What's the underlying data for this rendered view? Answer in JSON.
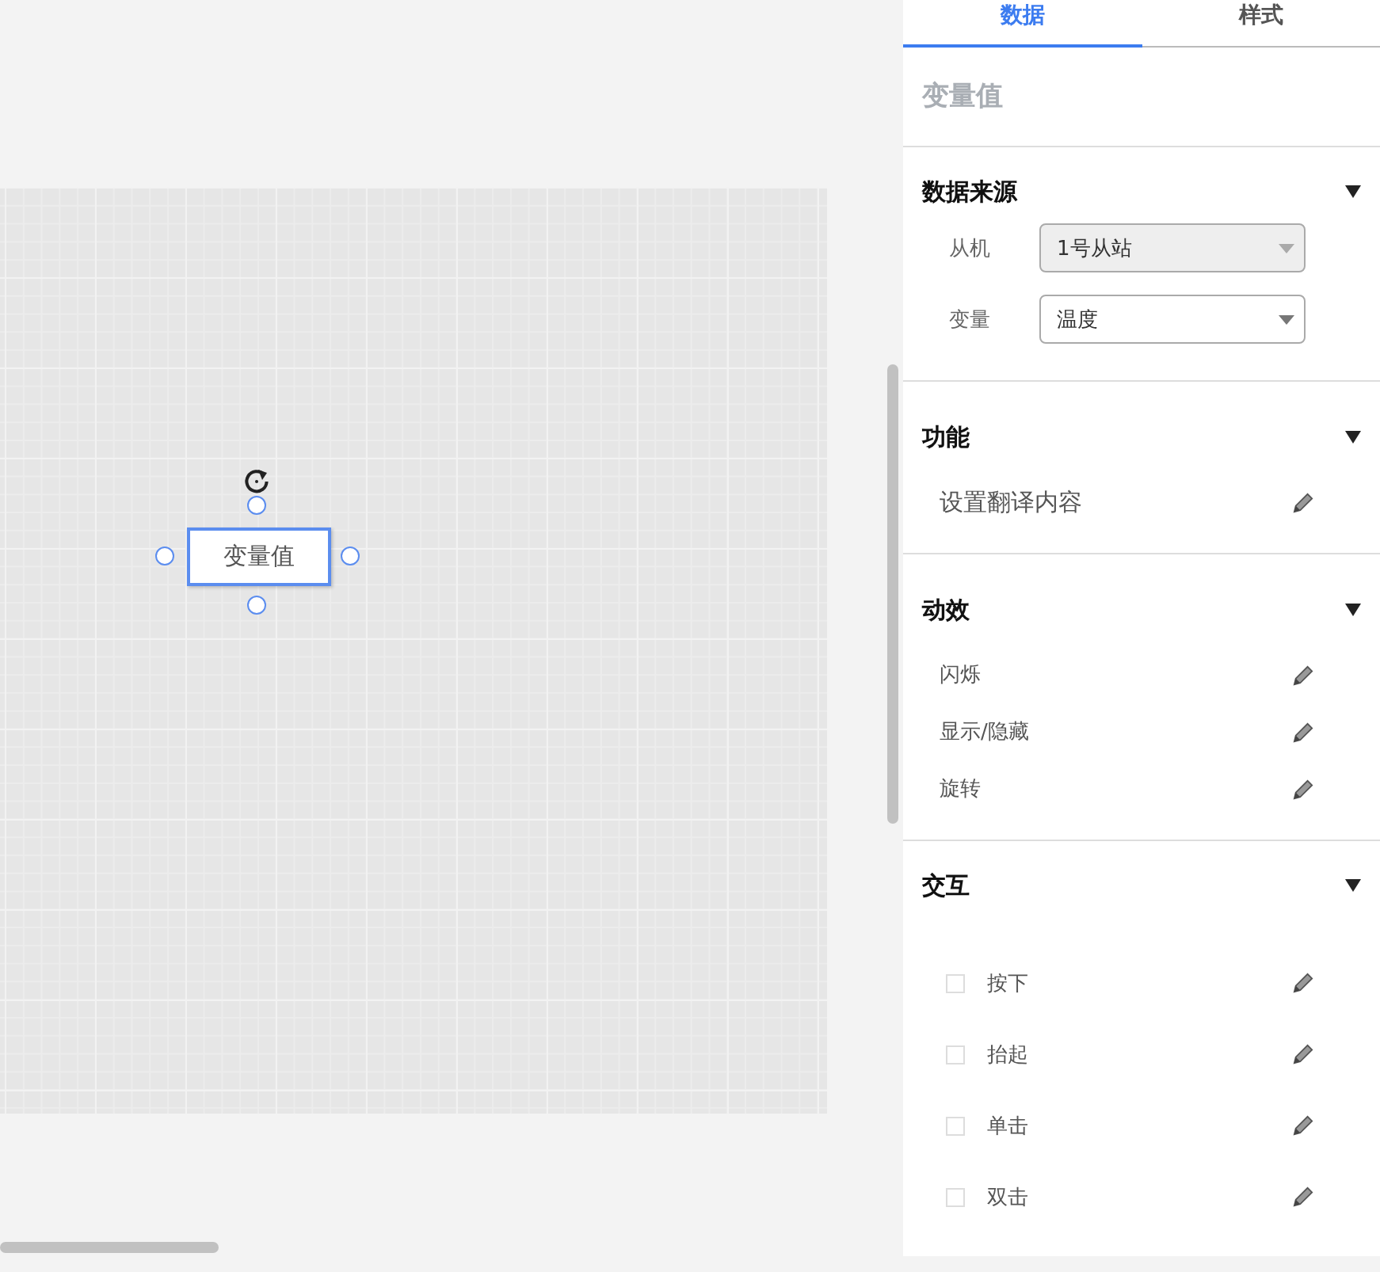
{
  "canvas": {
    "widget": {
      "label": "变量值",
      "selected": true
    }
  },
  "panel": {
    "tabs": [
      {
        "label": "数据",
        "selected": true
      },
      {
        "label": "样式",
        "selected": false
      }
    ],
    "title": "变量值",
    "sections": [
      {
        "kind": "fields",
        "title": "数据来源",
        "expanded": true,
        "fields": [
          {
            "label": "从机",
            "value": "1号从站",
            "disabled": true
          },
          {
            "label": "变量",
            "value": "温度",
            "disabled": false
          }
        ]
      },
      {
        "kind": "actions",
        "title": "功能",
        "expanded": true,
        "items": [
          {
            "label": "设置翻译内容"
          }
        ]
      },
      {
        "kind": "actions",
        "title": "动效",
        "expanded": true,
        "items": [
          {
            "label": "闪烁"
          },
          {
            "label": "显示/隐藏"
          },
          {
            "label": "旋转"
          }
        ]
      },
      {
        "kind": "checks",
        "title": "交互",
        "expanded": true,
        "items": [
          {
            "label": "按下",
            "checked": false
          },
          {
            "label": "抬起",
            "checked": false
          },
          {
            "label": "单击",
            "checked": false
          },
          {
            "label": "双击",
            "checked": false
          }
        ]
      }
    ]
  }
}
